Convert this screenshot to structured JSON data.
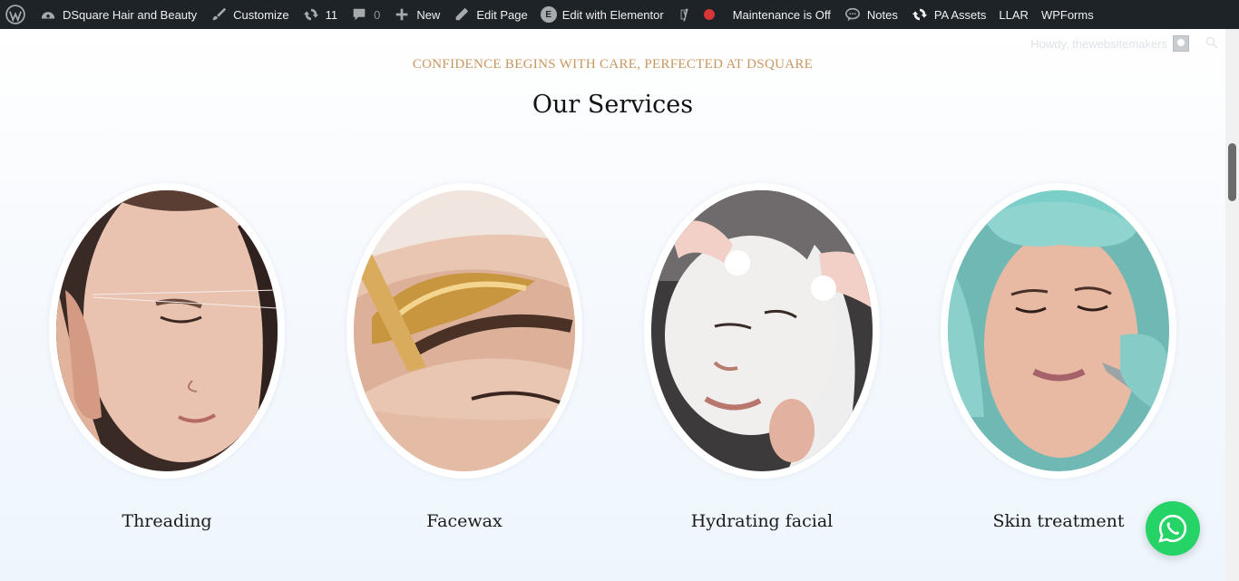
{
  "adminbar": {
    "site_name": "DSquare Hair and Beauty",
    "customize": "Customize",
    "updates_count": "11",
    "comments_count": "0",
    "new": "New",
    "edit_page": "Edit Page",
    "edit_elementor": "Edit with Elementor",
    "maintenance": "Maintenance is Off",
    "notes": "Notes",
    "pa_assets": "PA Assets",
    "llar": "LLAR",
    "wpforms": "WPForms",
    "howdy": "Howdy, thewebsitemakers"
  },
  "section": {
    "tagline": "CONFIDENCE BEGINS WITH CARE, PERFECTED AT DSQUARE",
    "title": "Our Services"
  },
  "services": [
    {
      "label": "Threading"
    },
    {
      "label": "Facewax"
    },
    {
      "label": "Hydrating facial"
    },
    {
      "label": "Skin treatment"
    }
  ],
  "colors": {
    "adminbar_bg": "#1d2327",
    "tagline": "#c9965f",
    "whatsapp": "#25d366",
    "maintenance_dot": "#d63638"
  }
}
